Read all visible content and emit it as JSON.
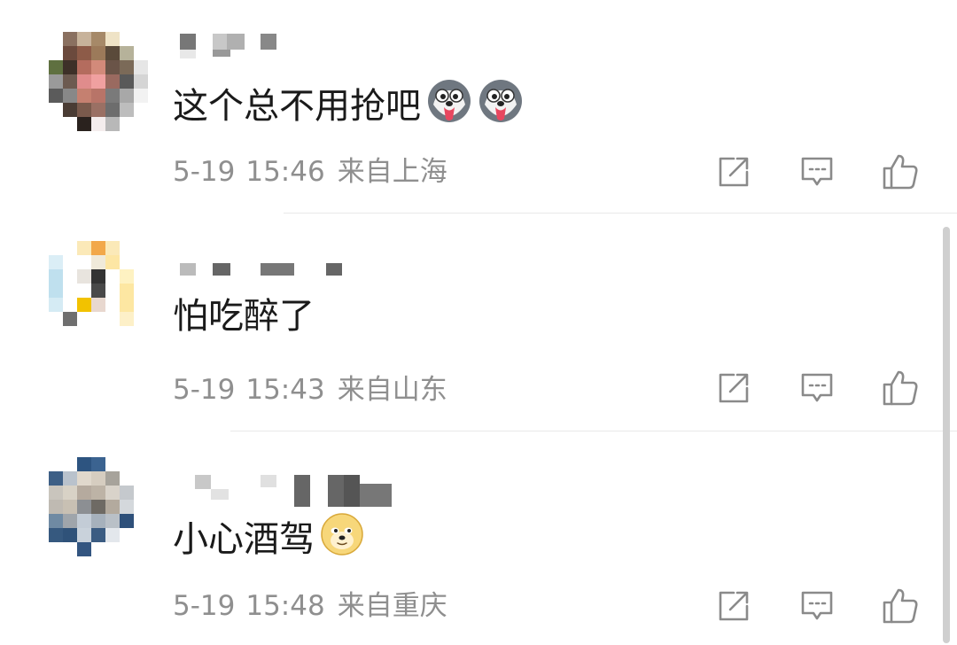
{
  "comments": [
    {
      "text": "这个总不用抢吧",
      "emojis": [
        "husky-icon",
        "husky-icon"
      ],
      "date": "5-19",
      "time": "15:46",
      "location": "来自上海"
    },
    {
      "text": "怕吃醉了",
      "emojis": [],
      "date": "5-19",
      "time": "15:43",
      "location": "来自山东"
    },
    {
      "text": "小心酒驾",
      "emojis": [
        "doge-icon"
      ],
      "date": "5-19",
      "time": "15:48",
      "location": "来自重庆"
    }
  ],
  "actions": [
    "share-icon",
    "reply-icon",
    "like-icon"
  ],
  "colors": {
    "text": "#1a1a1a",
    "meta": "#8f8f8f",
    "icon": "#8a8a8a",
    "divider": "#e9e9e9"
  }
}
